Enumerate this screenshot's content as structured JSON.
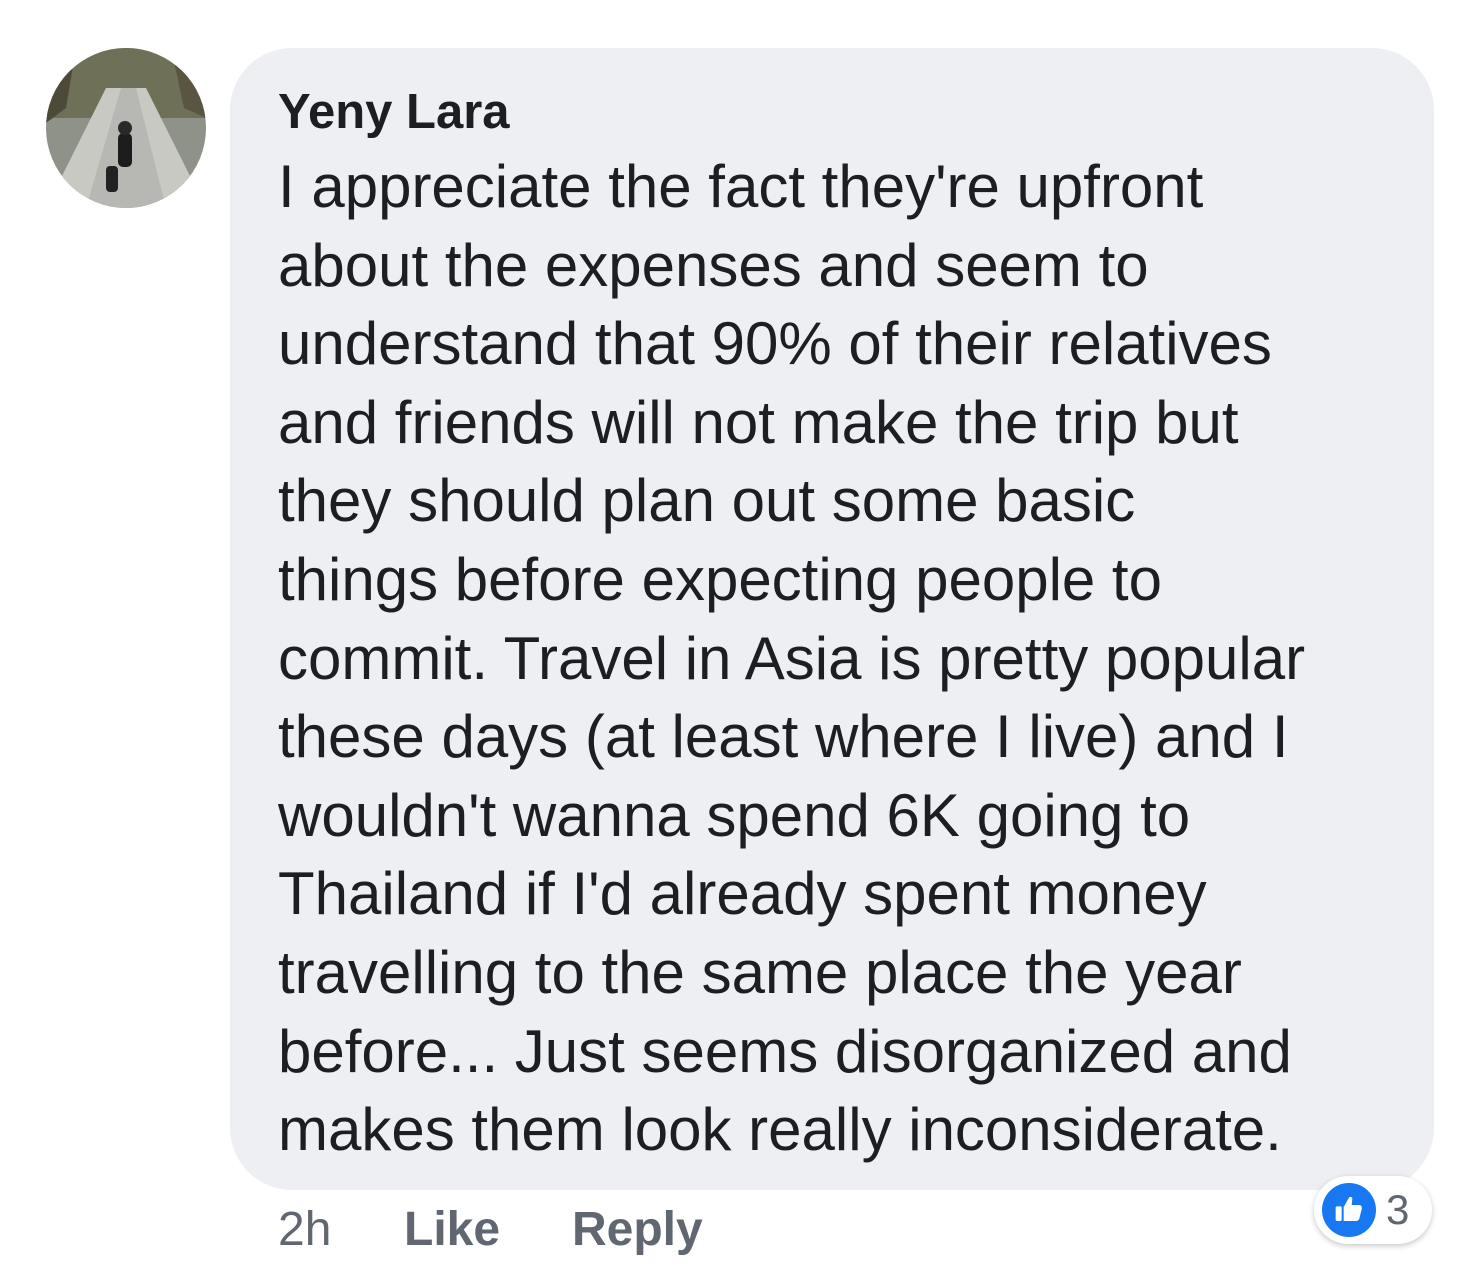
{
  "comment": {
    "author": "Yeny Lara",
    "text_lines": [
      "I appreciate the fact they're upfront",
      "about the expenses and seem to",
      "understand that 90% of their relatives",
      "and friends will not make the trip but",
      "they should plan out some basic",
      "things before expecting people to",
      "commit. Travel in Asia is pretty popular",
      "these days (at least where I live) and I",
      "wouldn't wanna spend 6K going to",
      "Thailand if I'd already spent money",
      "travelling to the same place the year",
      "before... Just seems disorganized and",
      "makes them look really inconsiderate."
    ],
    "bubble_color": "#edeff2"
  },
  "actions": {
    "time": "2h",
    "like_label": "Like",
    "reply_label": "Reply"
  },
  "reactions": {
    "icon": "thumbs-up-icon",
    "color": "#1877f2",
    "count": "3"
  }
}
